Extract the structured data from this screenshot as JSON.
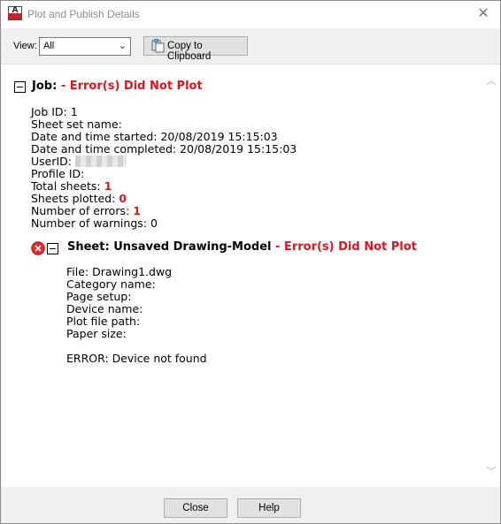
{
  "window": {
    "title": "Plot and Publish Details"
  },
  "toolbar": {
    "view_label": "View:",
    "view_value": "All",
    "copy_label": "Copy to Clipboard"
  },
  "job": {
    "heading_prefix": "Job:",
    "heading_status": "- Error(s) Did Not Plot",
    "lines": {
      "job_id": "Job ID: 1",
      "sheet_set_name": "Sheet set name:",
      "started": "Date and time started: 20/08/2019 15:15:03",
      "completed": "Date and time completed: 20/08/2019 15:15:03",
      "user_id_label": "UserID:",
      "profile_id": "Profile ID:",
      "total_sheets_label": "Total sheets:",
      "total_sheets_value": "1",
      "sheets_plotted_label": "Sheets plotted:",
      "sheets_plotted_value": "0",
      "errors_label": "Number of errors:",
      "errors_value": "1",
      "warnings": "Number of warnings: 0"
    }
  },
  "sheet": {
    "heading_prefix": "Sheet: Unsaved Drawing-Model",
    "heading_status": "- Error(s) Did Not Plot",
    "lines": {
      "file": "File: Drawing1.dwg",
      "category": "Category name:",
      "page_setup": "Page setup:",
      "device": "Device name:",
      "plot_file_path": "Plot file path:",
      "paper_size": "Paper size:",
      "error": "ERROR: Device not found"
    }
  },
  "buttons": {
    "close": "Close",
    "help": "Help"
  },
  "colors": {
    "error_red": "#e0141e",
    "app_red": "#d31f26",
    "window_bg": "#f0f0f0",
    "button_bg": "#e1e1e1"
  },
  "icons": {
    "app": "autocad-a-icon",
    "close": "close-icon",
    "dropdown": "chevron-down-icon",
    "clipboard": "clipboard-icon",
    "collapse": "collapse-minus-icon",
    "error": "error-circle-icon",
    "scroll_up": "scroll-up-icon",
    "scroll_down": "scroll-down-icon"
  }
}
